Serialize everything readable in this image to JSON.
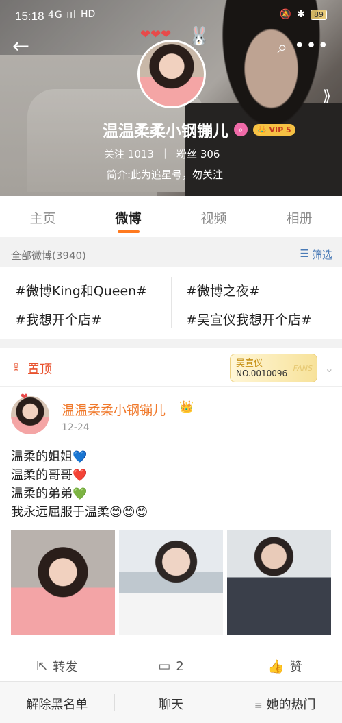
{
  "status": {
    "time": "15:18",
    "signal": "4G ııl",
    "network": "HD",
    "battery": "89"
  },
  "profile": {
    "name": "温温柔柔小钢镚儿",
    "vip": "VIP 5",
    "following_label": "关注",
    "following": "1013",
    "followers_label": "粉丝",
    "followers": "306",
    "bio": "简介:此为追星号，勿关注"
  },
  "tabs": [
    "主页",
    "微博",
    "视频",
    "相册"
  ],
  "filter": {
    "all": "全部微博(3940)",
    "filter_label": "筛选"
  },
  "topics": [
    "#微博King和Queen#",
    "#微博之夜#",
    "#我想开个店#",
    "#吴宣仪我想开个店#"
  ],
  "pinned": {
    "label": "置顶",
    "fan_name": "吴宣仪",
    "fan_no": "NO.0010096",
    "fans_text": "FANS"
  },
  "post": {
    "author": "温温柔柔小钢镚儿",
    "date": "12-24",
    "lines": [
      "温柔的姐姐",
      "温柔的哥哥",
      "温柔的弟弟",
      "我永远屈服于温柔"
    ],
    "actions": {
      "repost": "转发",
      "comments": "2",
      "like": "赞"
    }
  },
  "bottom": {
    "unblock": "解除黑名单",
    "chat": "聊天",
    "hot": "她的热门"
  },
  "colors": {
    "accent": "#ff7a1f",
    "name_orange": "#f0792b",
    "pin_red": "#e8522e",
    "link_blue": "#4a7bb7"
  }
}
